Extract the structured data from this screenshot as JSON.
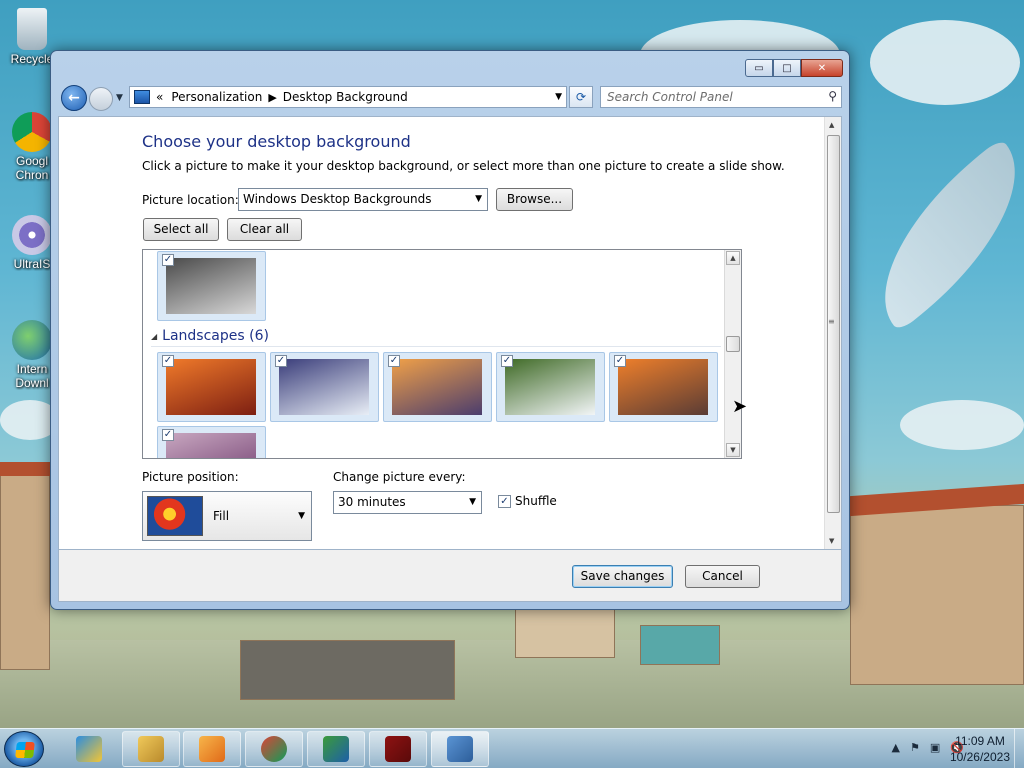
{
  "desktop": {
    "icons": [
      {
        "label": "Recycle",
        "name": "recycle-bin-icon"
      },
      {
        "label": "Googl Chron",
        "name": "google-chrome-shortcut-icon"
      },
      {
        "label": "UltraIS",
        "name": "ultraiso-shortcut-icon"
      },
      {
        "label": "Intern Downl",
        "name": "internet-download-manager-shortcut-icon"
      }
    ]
  },
  "window": {
    "caption_buttons": {
      "minimize": "▭",
      "maximize": "□",
      "close": "✕"
    },
    "nav": {
      "back_glyph": "←",
      "breadcrumb_prefix": "«",
      "breadcrumb": [
        "Personalization",
        "Desktop Background"
      ],
      "breadcrumb_sep": "▶",
      "refresh_glyph": "⟳",
      "search_placeholder": "Search Control Panel",
      "search_glyph": "⚲"
    },
    "heading": "Choose your desktop background",
    "description": "Click a picture to make it your desktop background, or select more than one picture to create a slide show.",
    "picture_location": {
      "label": "Picture location:",
      "value": "Windows Desktop Backgrounds",
      "browse_label": "Browse..."
    },
    "select_all_label": "Select all",
    "clear_all_label": "Clear all",
    "gallery": {
      "group_title": "Landscapes (6)",
      "check_glyph": "✓",
      "thumbnails": [
        {
          "name": "thumb-characters",
          "checked": true,
          "colors": [
            "#4a4a4a",
            "#d8d8d8"
          ]
        },
        {
          "name": "thumb-landscape-canyon",
          "checked": true,
          "colors": [
            "#f07a2a",
            "#7d1f12"
          ]
        },
        {
          "name": "thumb-landscape-ice-lake",
          "checked": true,
          "colors": [
            "#3a3d7a",
            "#e8eef6"
          ]
        },
        {
          "name": "thumb-landscape-coast-rocks",
          "checked": true,
          "colors": [
            "#f0a048",
            "#4b3d6d"
          ]
        },
        {
          "name": "thumb-landscape-waterfall",
          "checked": true,
          "colors": [
            "#3f6a26",
            "#f2f5f7"
          ]
        },
        {
          "name": "thumb-landscape-arch",
          "checked": true,
          "colors": [
            "#ee7f2b",
            "#5a3c35"
          ]
        },
        {
          "name": "thumb-landscape-lavender",
          "checked": true,
          "colors": [
            "#c8a7c0",
            "#6d3a6d"
          ]
        }
      ]
    },
    "picture_position": {
      "label": "Picture position:",
      "value": "Fill"
    },
    "change_picture": {
      "label": "Change picture every:",
      "value": "30 minutes"
    },
    "shuffle": {
      "label": "Shuffle",
      "checked": true
    },
    "save_label": "Save changes",
    "cancel_label": "Cancel"
  },
  "taskbar": {
    "items": [
      {
        "name": "internet-explorer-icon",
        "colors": [
          "#2b8de0",
          "#f3c534"
        ]
      },
      {
        "name": "file-explorer-icon",
        "colors": [
          "#f0c95a",
          "#b98a2c"
        ]
      },
      {
        "name": "media-player-icon",
        "colors": [
          "#f7b54a",
          "#e06a18"
        ]
      },
      {
        "name": "chrome-icon",
        "colors": [
          "#db4437",
          "#0f9d58"
        ]
      },
      {
        "name": "download-manager-icon",
        "colors": [
          "#3b9b3a",
          "#1e5fa8"
        ]
      },
      {
        "name": "flash-icon",
        "colors": [
          "#8e1212",
          "#5a0a0a"
        ]
      },
      {
        "name": "control-panel-icon",
        "colors": [
          "#5a94d4",
          "#2d5e9a"
        ]
      }
    ],
    "tray_icons": [
      "▲",
      "⚑",
      "▣",
      "🔇"
    ],
    "time": "11:09 AM",
    "date": "10/26/2023"
  }
}
